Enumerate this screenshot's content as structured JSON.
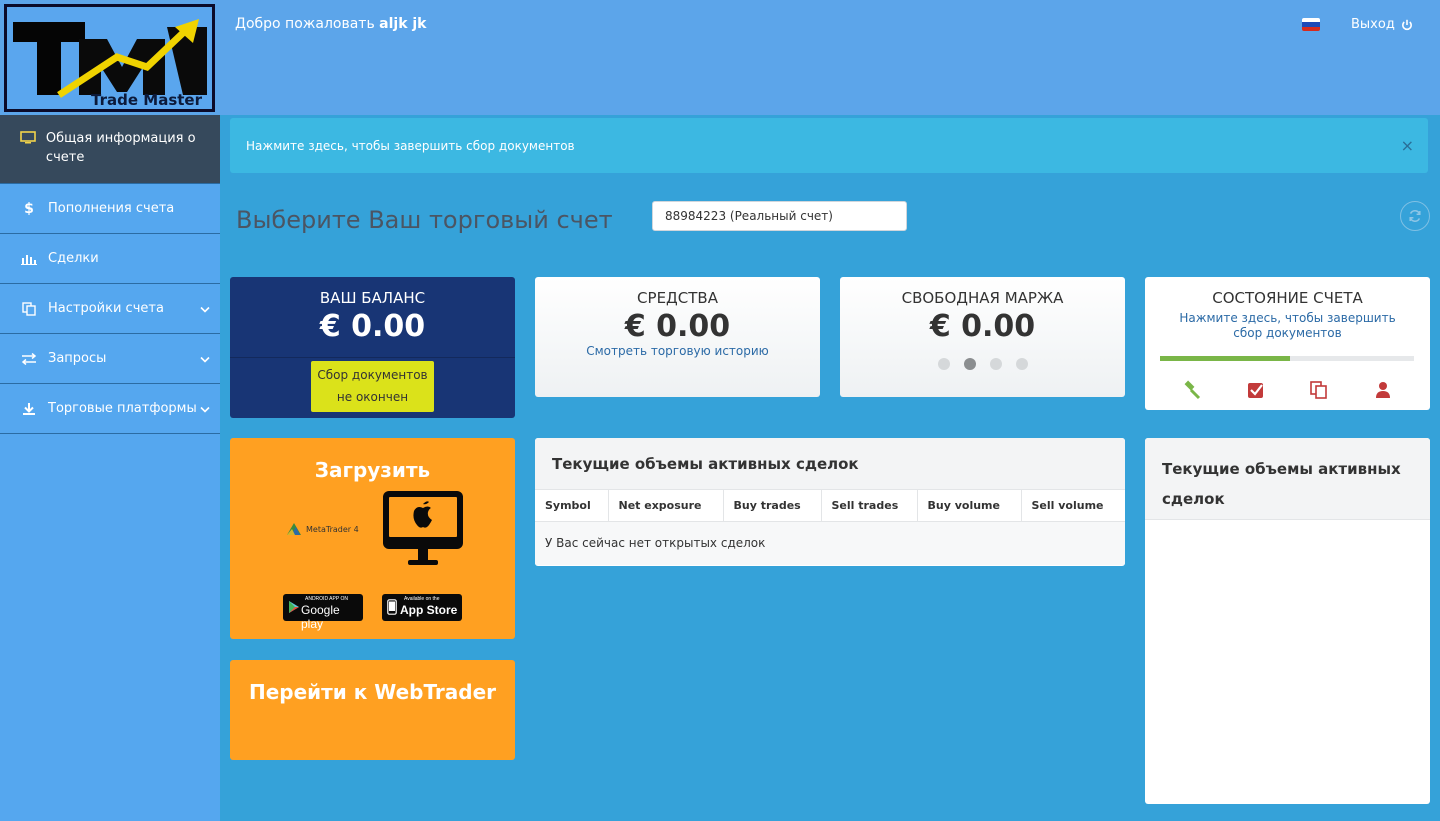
{
  "header": {
    "logo_text": "Trade Master",
    "welcome": "Добро пожаловать",
    "username": "aljk jk",
    "logout": "Выход",
    "flag_colors": [
      "#ffffff",
      "#1c4ab8",
      "#d52b1e"
    ]
  },
  "sidebar": {
    "items": [
      {
        "label": "Общая информация о счете",
        "icon": "monitor-icon",
        "active": true
      },
      {
        "label": "Пополнения счета",
        "icon": "dollar-icon"
      },
      {
        "label": "Сделки",
        "icon": "bar-chart-icon"
      },
      {
        "label": "Настройки счета",
        "icon": "copy-icon",
        "expandable": true
      },
      {
        "label": "Запросы",
        "icon": "exchange-icon",
        "expandable": true
      },
      {
        "label": "Торговые платформы",
        "icon": "download-icon",
        "expandable": true
      }
    ]
  },
  "alert": {
    "text": "Нажмите здесь, чтобы завершить сбор документов",
    "close": "×"
  },
  "account": {
    "title": "Выберите Ваш торговый счет",
    "selected": "88984223 (Реальный счет)"
  },
  "cards": {
    "balance": {
      "title": "ВАШ БАЛАНС",
      "value": "€ 0.00",
      "button": "Сбор документов не окончен"
    },
    "funds": {
      "title": "СРЕДСТВА",
      "value": "€ 0.00",
      "link": "Смотреть торговую историю"
    },
    "margin": {
      "title": "СВОБОДНАЯ МАРЖА",
      "value": "€ 0.00"
    },
    "state": {
      "title": "СОСТОЯНИЕ СЧЕТА",
      "link": "Нажмите здесь, чтобы завершить сбор документов",
      "progress": 0.51
    }
  },
  "download": {
    "title": "Загрузить",
    "metatrader": "MetaTrader 4",
    "google_small": "ANDROID APP ON",
    "google_big": "Google play",
    "apple_small": "Available on the",
    "apple_big": "App Store"
  },
  "webtrader": {
    "label": "Перейти к WebTrader"
  },
  "trades": {
    "title": "Текущие объемы активных сделок",
    "columns": [
      "Symbol",
      "Net exposure",
      "Buy trades",
      "Sell trades",
      "Buy volume",
      "Sell volume"
    ],
    "empty": "У Вас сейчас нет открытых сделок"
  },
  "right_panel": {
    "title": "Текущие объемы активных сделок"
  }
}
